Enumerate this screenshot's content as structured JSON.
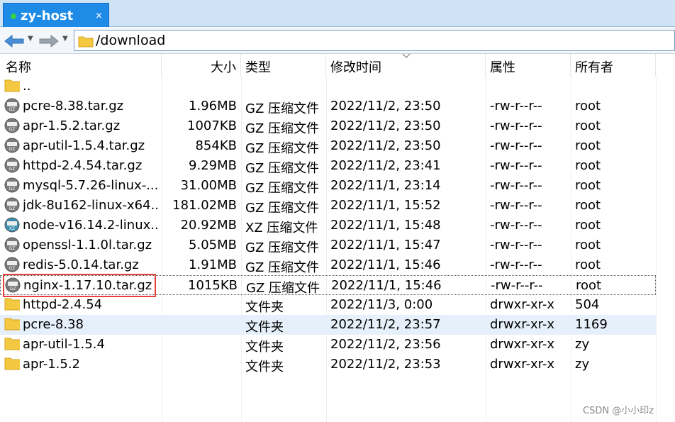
{
  "tab": {
    "title": "zy-host",
    "close": "×"
  },
  "path": {
    "value": "/download"
  },
  "columns": [
    "名称",
    "大小",
    "类型",
    "修改时间",
    "属性",
    "所有者"
  ],
  "rows": [
    {
      "name": "..",
      "size": "",
      "type": "",
      "mtime": "",
      "attr": "",
      "owner": "",
      "icon": "folder-icon"
    },
    {
      "name": "pcre-8.38.tar.gz",
      "size": "1.96MB",
      "type": "GZ 压缩文件",
      "mtime": "2022/11/2, 23:50",
      "attr": "-rw-r--r--",
      "owner": "root",
      "icon": "gz-archive-icon"
    },
    {
      "name": "apr-1.5.2.tar.gz",
      "size": "1007KB",
      "type": "GZ 压缩文件",
      "mtime": "2022/11/2, 23:50",
      "attr": "-rw-r--r--",
      "owner": "root",
      "icon": "gz-archive-icon"
    },
    {
      "name": "apr-util-1.5.4.tar.gz",
      "size": "854KB",
      "type": "GZ 压缩文件",
      "mtime": "2022/11/2, 23:50",
      "attr": "-rw-r--r--",
      "owner": "root",
      "icon": "gz-archive-icon"
    },
    {
      "name": "httpd-2.4.54.tar.gz",
      "size": "9.29MB",
      "type": "GZ 压缩文件",
      "mtime": "2022/11/2, 23:41",
      "attr": "-rw-r--r--",
      "owner": "root",
      "icon": "gz-archive-icon"
    },
    {
      "name": "mysql-5.7.26-linux-...",
      "size": "31.00MB",
      "type": "GZ 压缩文件",
      "mtime": "2022/11/1, 23:14",
      "attr": "-rw-r--r--",
      "owner": "root",
      "icon": "gz-archive-icon"
    },
    {
      "name": "jdk-8u162-linux-x64...",
      "size": "181.02MB",
      "type": "GZ 压缩文件",
      "mtime": "2022/11/1, 15:52",
      "attr": "-rw-r--r--",
      "owner": "root",
      "icon": "gz-archive-icon"
    },
    {
      "name": "node-v16.14.2-linux...",
      "size": "20.92MB",
      "type": "XZ 压缩文件",
      "mtime": "2022/11/1, 15:48",
      "attr": "-rw-r--r--",
      "owner": "root",
      "icon": "xz-archive-icon"
    },
    {
      "name": "openssl-1.1.0l.tar.gz",
      "size": "5.05MB",
      "type": "GZ 压缩文件",
      "mtime": "2022/11/1, 15:47",
      "attr": "-rw-r--r--",
      "owner": "root",
      "icon": "gz-archive-icon"
    },
    {
      "name": "redis-5.0.14.tar.gz",
      "size": "1.91MB",
      "type": "GZ 压缩文件",
      "mtime": "2022/11/1, 15:46",
      "attr": "-rw-r--r--",
      "owner": "root",
      "icon": "gz-archive-icon"
    },
    {
      "name": "nginx-1.17.10.tar.gz",
      "size": "1015KB",
      "type": "GZ 压缩文件",
      "mtime": "2022/11/1, 15:46",
      "attr": "-rw-r--r--",
      "owner": "root",
      "icon": "gz-archive-icon"
    },
    {
      "name": "httpd-2.4.54",
      "size": "",
      "type": "文件夹",
      "mtime": "2022/11/3, 0:00",
      "attr": "drwxr-xr-x",
      "owner": "504",
      "icon": "folder-icon"
    },
    {
      "name": "pcre-8.38",
      "size": "",
      "type": "文件夹",
      "mtime": "2022/11/2, 23:57",
      "attr": "drwxr-xr-x",
      "owner": "1169",
      "icon": "folder-icon"
    },
    {
      "name": "apr-util-1.5.4",
      "size": "",
      "type": "文件夹",
      "mtime": "2022/11/2, 23:56",
      "attr": "drwxr-xr-x",
      "owner": "zy",
      "icon": "folder-icon"
    },
    {
      "name": "apr-1.5.2",
      "size": "",
      "type": "文件夹",
      "mtime": "2022/11/2, 23:53",
      "attr": "drwxr-xr-x",
      "owner": "zy",
      "icon": "folder-icon"
    }
  ],
  "watermark": "CSDN @小小印z",
  "colors": {
    "tab": "#1e8be6",
    "selected_row": "#e6f0fa",
    "highlight_box": "#e8413c",
    "folder": "#f5c842"
  }
}
